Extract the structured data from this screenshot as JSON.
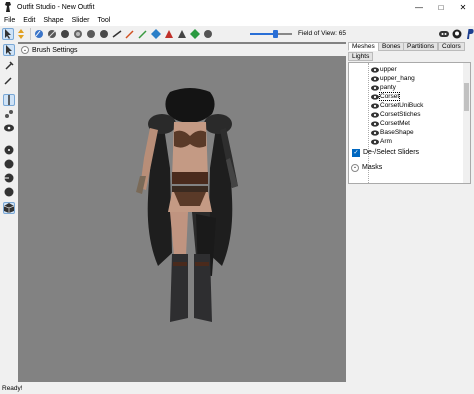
{
  "window": {
    "title": "Outfit Studio - New Outfit",
    "controls": [
      "minimize",
      "maximize",
      "close"
    ]
  },
  "menu": {
    "items": [
      "File",
      "Edit",
      "Shape",
      "Slider",
      "Tool"
    ]
  },
  "toolbar": {
    "fov_label": "Field of View: 65",
    "fov_value": 65
  },
  "brush": {
    "header": "Brush Settings"
  },
  "tabs": [
    "Meshes",
    "Bones",
    "Partitions",
    "Colors",
    "Lights"
  ],
  "meshes": [
    "upper",
    "upper_hang",
    "panty",
    "Corset",
    "CorsetUniBuck",
    "CorsetStiches",
    "CorsetMet",
    "BaseShape",
    "Arm"
  ],
  "selected_mesh": "Corset",
  "sliders": {
    "deselect_label": "De-/Select Sliders",
    "masks_label": "Masks"
  },
  "status": {
    "text": "Ready!"
  },
  "colors": {
    "accent": "#0067c0",
    "viewport_bg": "#828282"
  }
}
